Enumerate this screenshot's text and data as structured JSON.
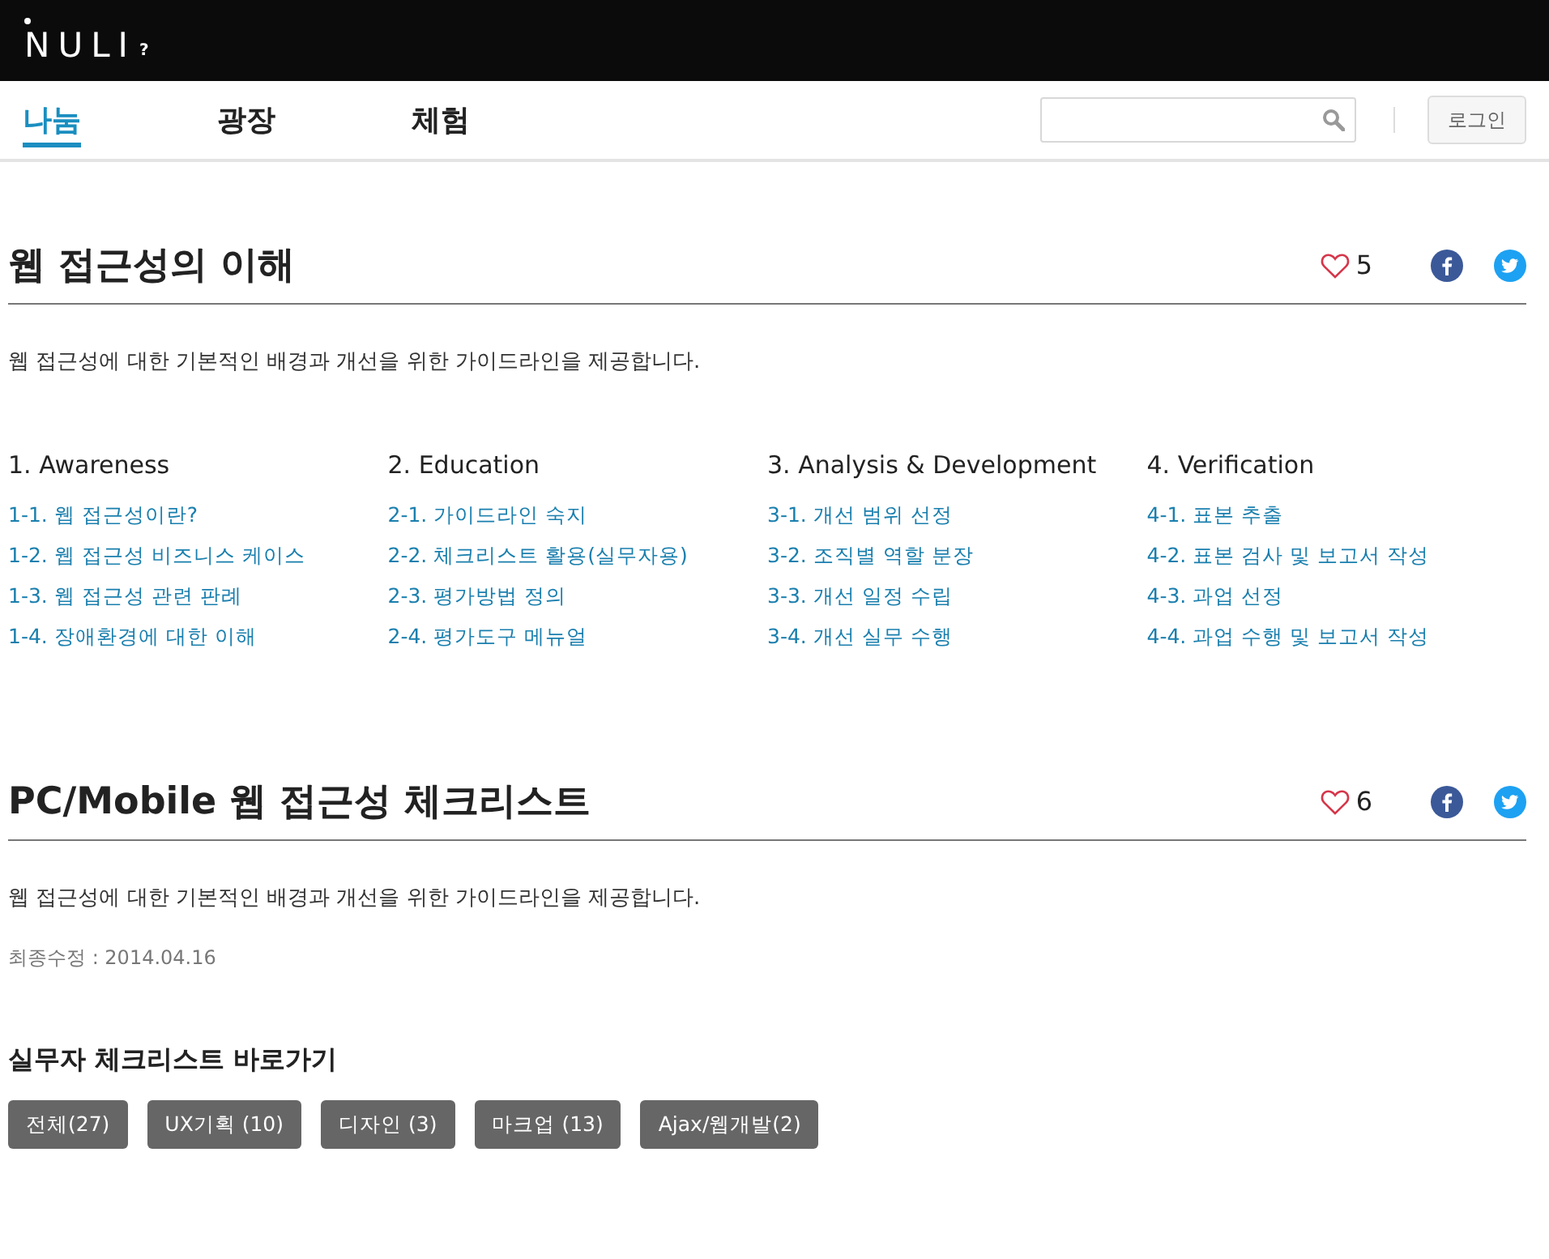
{
  "header": {
    "logo": "NULI",
    "logo_mark": "?"
  },
  "nav": {
    "tabs": [
      {
        "label": "나눔",
        "selected": true
      },
      {
        "label": "광장",
        "selected": false
      },
      {
        "label": "체험",
        "selected": false
      }
    ],
    "login": "로그인"
  },
  "sections": [
    {
      "title": "웹 접근성의 이해",
      "likes": "5",
      "description": "웹 접근성에 대한 기본적인 배경과 개선을 위한 가이드라인을 제공합니다.",
      "columns": [
        {
          "heading": "1. Awareness",
          "links": [
            "1-1. 웹 접근성이란?",
            "1-2. 웹 접근성 비즈니스 케이스",
            "1-3. 웹 접근성 관련 판례",
            "1-4. 장애환경에 대한 이해"
          ]
        },
        {
          "heading": "2. Education",
          "links": [
            "2-1. 가이드라인 숙지",
            "2-2. 체크리스트 활용(실무자용)",
            "2-3. 평가방법 정의",
            "2-4. 평가도구 메뉴얼"
          ]
        },
        {
          "heading": "3. Analysis & Development",
          "links": [
            "3-1. 개선 범위 선정",
            "3-2. 조직별 역할 분장",
            "3-3. 개선 일정 수립",
            "3-4. 개선 실무 수행"
          ]
        },
        {
          "heading": "4. Verification",
          "links": [
            "4-1. 표본 추출",
            "4-2. 표본 검사 및 보고서 작성",
            "4-3. 과업 선정",
            "4-4. 과업 수행 및 보고서 작성"
          ]
        }
      ]
    },
    {
      "title": "PC/Mobile 웹 접근성 체크리스트",
      "likes": "6",
      "description": "웹 접근성에 대한 기본적인 배경과 개선을 위한 가이드라인을 제공합니다.",
      "updated": "최종수정 : 2014.04.16",
      "subheading": "실무자 체크리스트 바로가기",
      "buttons": [
        "전체(27)",
        "UX기획 (10)",
        "디자인 (3)",
        "마크업 (13)",
        "Ajax/웹개발(2)"
      ]
    }
  ]
}
